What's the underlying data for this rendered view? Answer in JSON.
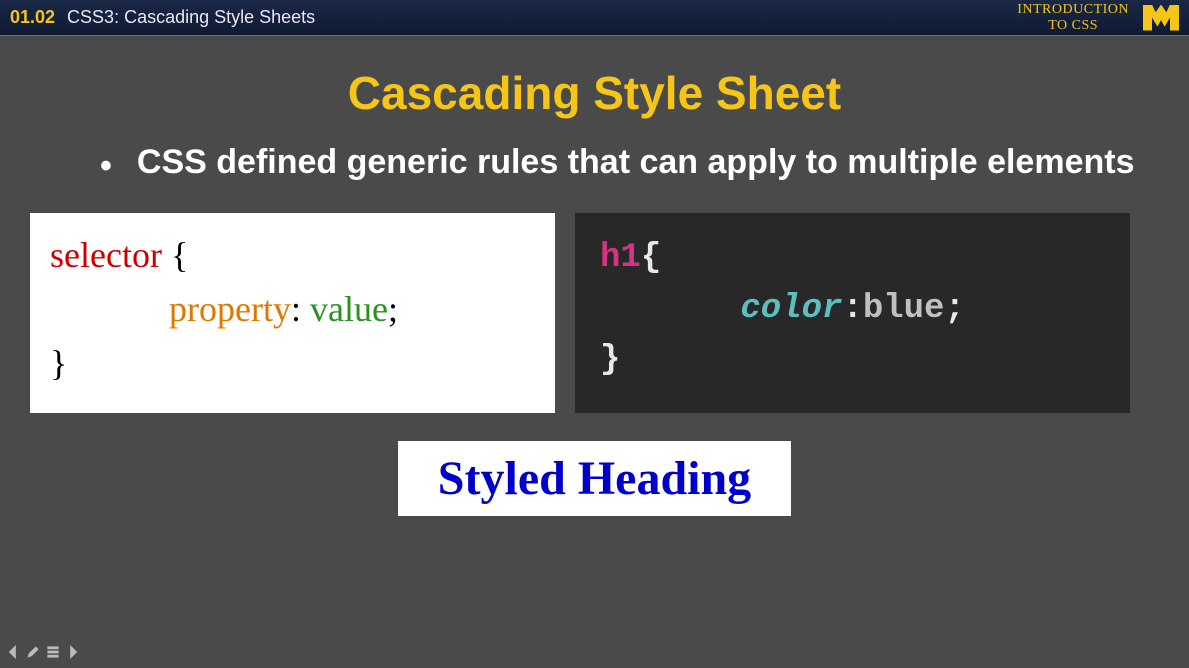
{
  "header": {
    "lesson_number": "01.02",
    "lesson_title": "CSS3: Cascading Style Sheets",
    "course_line1": "INTRODUCTION",
    "course_line2": "TO CSS"
  },
  "slide": {
    "title": "Cascading Style Sheet",
    "bullet_text": "CSS defined generic rules that can apply to multiple elements"
  },
  "code_left": {
    "selector": "selector",
    "brace_open": "{",
    "property": "property",
    "colon": ":",
    "value": "value",
    "semi": ";",
    "brace_close": "}"
  },
  "code_right": {
    "tag": "h1",
    "brace_open": "{",
    "property": "color",
    "colon": ":",
    "value": "blue",
    "semi": ";",
    "brace_close": "}"
  },
  "result": {
    "text": "Styled Heading"
  }
}
